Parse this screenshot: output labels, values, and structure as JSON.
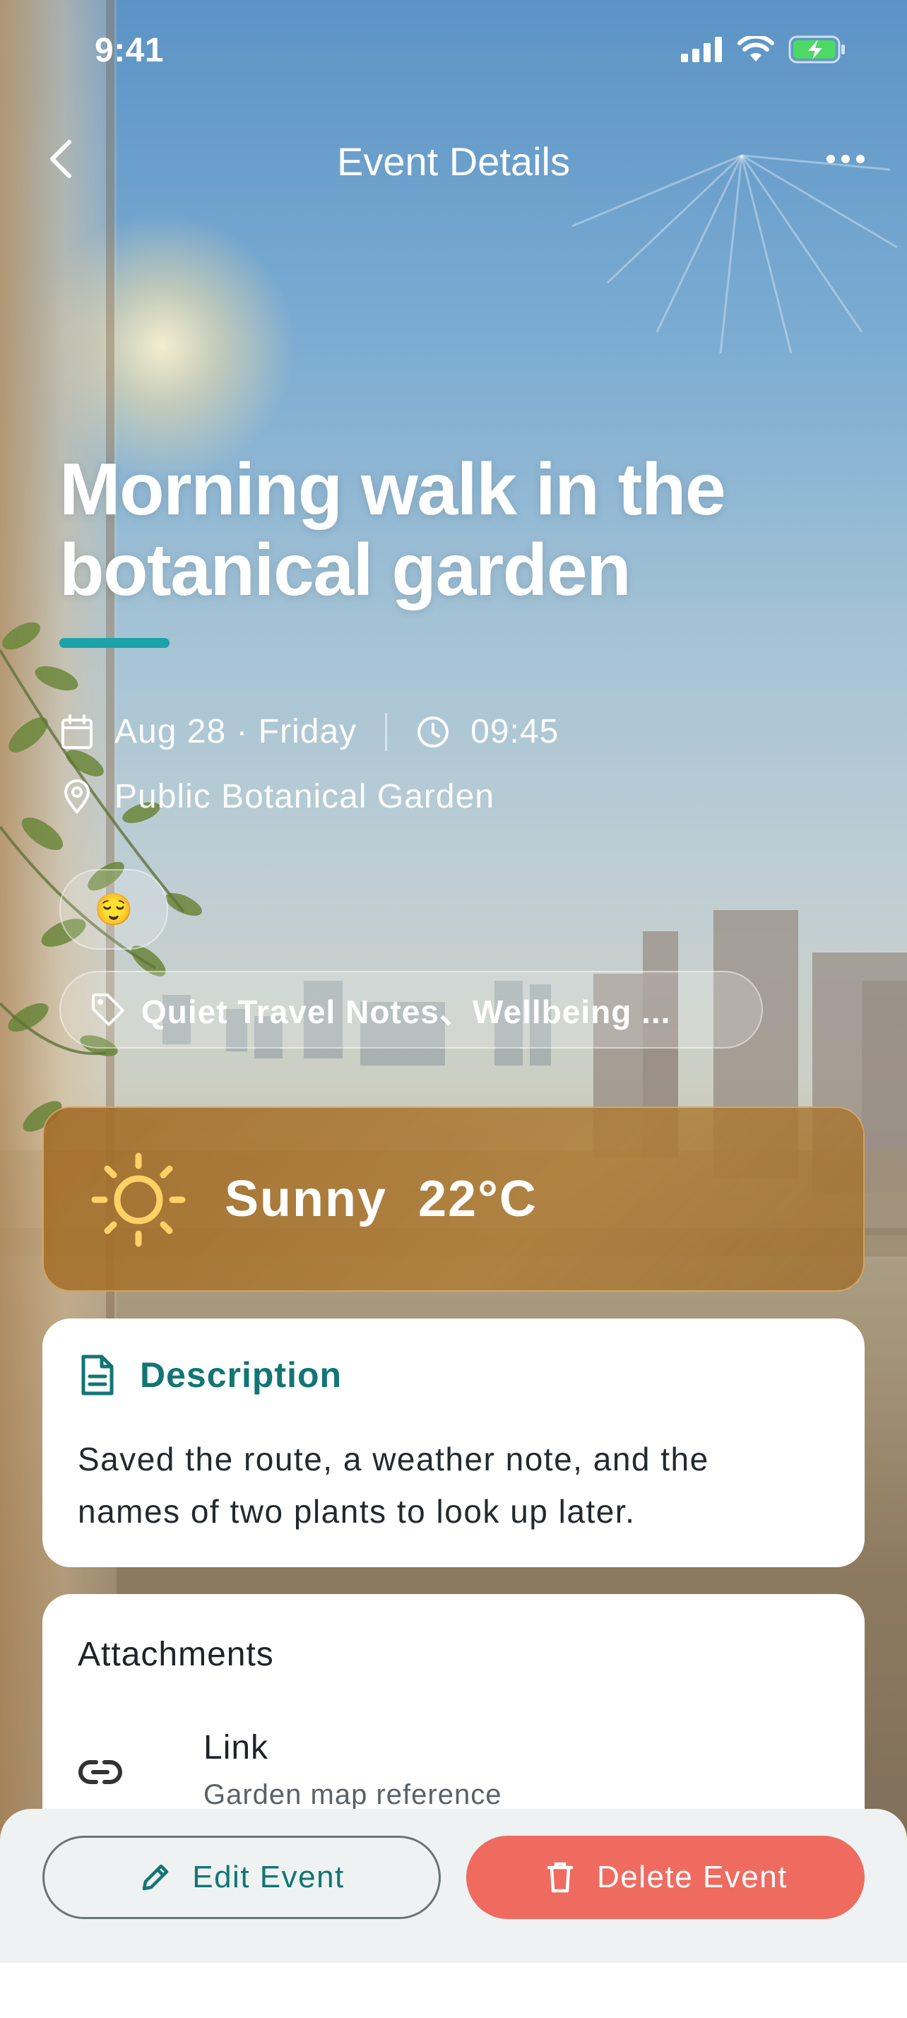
{
  "status_bar": {
    "time": "9:41"
  },
  "nav": {
    "title": "Event Details"
  },
  "event": {
    "title": "Morning walk in the botanical garden",
    "date": "Aug 28 · Friday",
    "time": "09:45",
    "location": "Public Botanical Garden",
    "mood_emoji": "😌",
    "tags": "Quiet Travel Notes、Wellbeing ..."
  },
  "weather": {
    "label": "Sunny  22°C"
  },
  "description": {
    "heading": "Description",
    "text": "Saved the route, a weather note, and the names of two plants to look up later."
  },
  "attachments": {
    "heading": "Attachments",
    "items": [
      {
        "type": "Link",
        "subtitle": "Garden map reference"
      }
    ]
  },
  "actions": {
    "edit_label": "Edit Event",
    "delete_label": "Delete Event"
  },
  "colors": {
    "accent": "#1aa3a8",
    "teal_text": "#137574",
    "delete": "#ef6b60",
    "weather_card": "#a66c24",
    "sun": "#ffd166"
  },
  "icons": [
    "back-chevron-icon",
    "more-icon",
    "calendar-icon",
    "clock-icon",
    "location-pin-icon",
    "tag-icon",
    "sun-icon",
    "document-icon",
    "link-icon",
    "pencil-icon",
    "trash-icon",
    "signal-icon",
    "wifi-icon",
    "battery-icon"
  ]
}
